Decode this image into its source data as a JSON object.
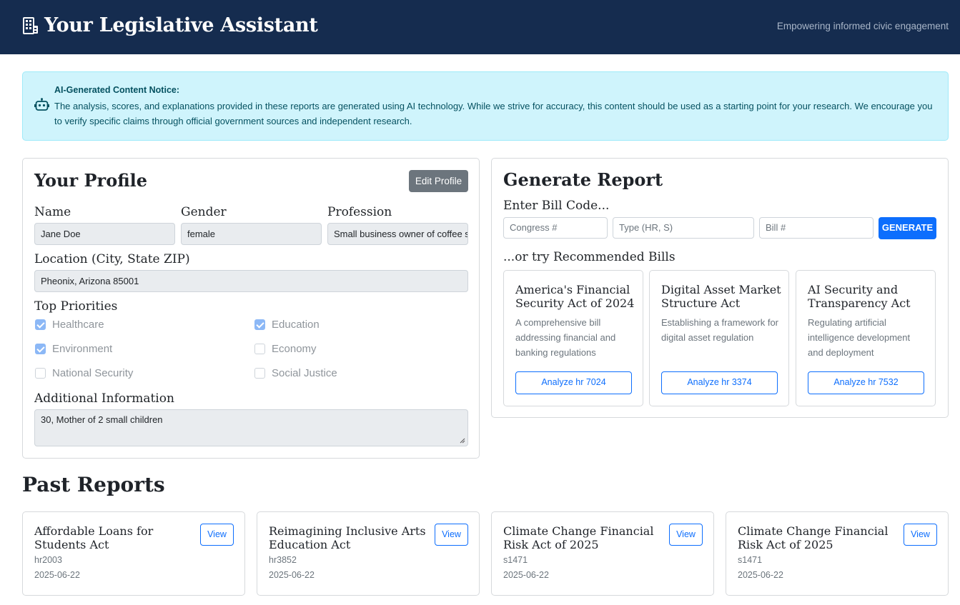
{
  "header": {
    "title": "Your Legislative Assistant",
    "tagline": "Empowering informed civic engagement",
    "icon": "building-icon"
  },
  "notice": {
    "icon": "robot-icon",
    "title": "AI-Generated Content Notice:",
    "text": "The analysis, scores, and explanations provided in these reports are generated using AI technology. While we strive for accuracy, this content should be used as a starting point for your research. We encourage you to verify specific claims through official government sources and independent research."
  },
  "profile": {
    "heading": "Your Profile",
    "edit_label": "Edit Profile",
    "name_label": "Name",
    "name_value": "Jane Doe",
    "gender_label": "Gender",
    "gender_value": "female",
    "profession_label": "Profession",
    "profession_value": "Small business owner of coffee shop",
    "location_label": "Location (City, State ZIP)",
    "location_value": "Pheonix, Arizona 85001",
    "priorities_label": "Top Priorities",
    "priorities": [
      {
        "label": "Healthcare",
        "checked": true
      },
      {
        "label": "Education",
        "checked": true
      },
      {
        "label": "Environment",
        "checked": true
      },
      {
        "label": "Economy",
        "checked": false
      },
      {
        "label": "National Security",
        "checked": false
      },
      {
        "label": "Social Justice",
        "checked": false
      }
    ],
    "additional_label": "Additional Information",
    "additional_value": "30, Mother of 2 small children"
  },
  "generate": {
    "heading": "Generate Report",
    "enter_label": "Enter Bill Code...",
    "congress_placeholder": "Congress #",
    "type_placeholder": "Type (HR, S)",
    "bill_placeholder": "Bill #",
    "button_label": "GENERATE",
    "recommended_label": "...or try Recommended Bills",
    "recommended": [
      {
        "title": "America's Financial Security Act of 2024",
        "desc": "A comprehensive bill addressing financial and banking regulations",
        "button": "Analyze hr 7024"
      },
      {
        "title": "Digital Asset Market Structure Act",
        "desc": "Establishing a framework for digital asset regulation",
        "button": "Analyze hr 3374"
      },
      {
        "title": "AI Security and Transparency Act",
        "desc": "Regulating artificial intelligence development and deployment",
        "button": "Analyze hr 7532"
      }
    ]
  },
  "past": {
    "heading": "Past Reports",
    "view_label": "View",
    "reports": [
      {
        "title": "Affordable Loans for Students Act",
        "code": "hr2003",
        "date": "2025-06-22"
      },
      {
        "title": "Reimagining Inclusive Arts Education Act",
        "code": "hr3852",
        "date": "2025-06-22"
      },
      {
        "title": "Climate Change Financial Risk Act of 2025",
        "code": "s1471",
        "date": "2025-06-22"
      },
      {
        "title": "Climate Change Financial Risk Act of 2025",
        "code": "s1471",
        "date": "2025-06-22"
      }
    ]
  }
}
